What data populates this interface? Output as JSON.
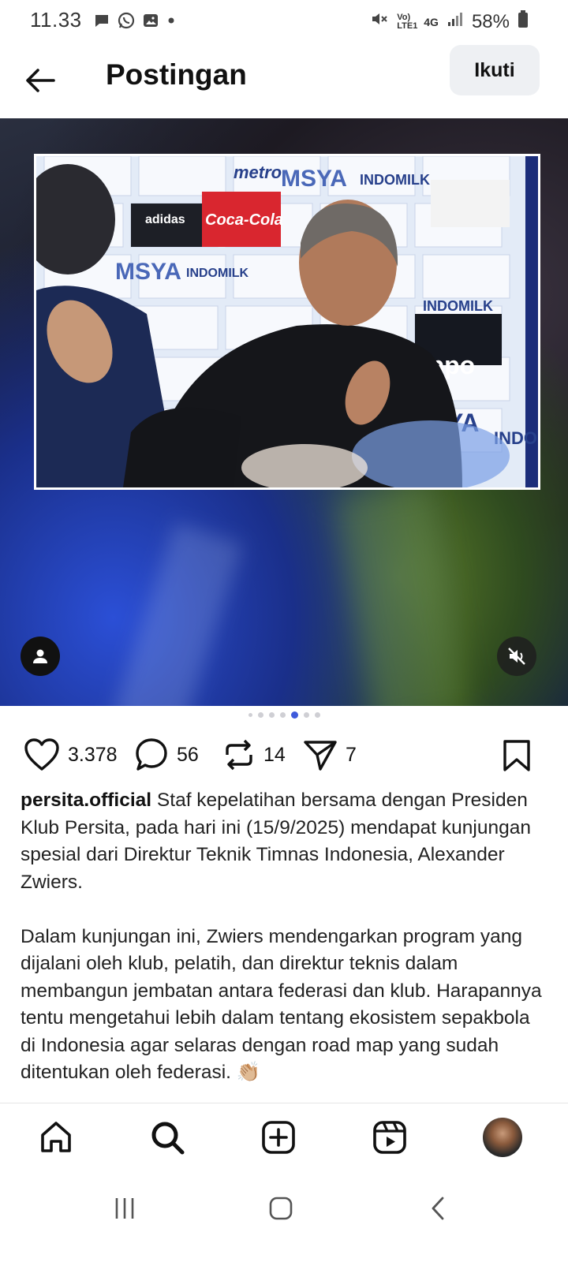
{
  "status_bar": {
    "time": "11.33",
    "network_label": "Vo) LTE1",
    "network_type": "4G",
    "battery": "58%",
    "icons": [
      "chat-icon",
      "whatsapp-icon",
      "gallery-icon",
      "dot-icon",
      "mute-icon",
      "signal-icon",
      "battery-icon"
    ]
  },
  "header": {
    "title": "Postingan",
    "follow_label": "Ikuti"
  },
  "media": {
    "sponsors": [
      "metro",
      "MSYA",
      "INDOMILK",
      "adidas",
      "Coca-Cola",
      "MSYA",
      "INDOMILK",
      "INDOMILK",
      "oppo",
      "YA",
      "INDO"
    ],
    "carousel_total": 7,
    "carousel_active": 5
  },
  "actions": {
    "likes": "3.378",
    "comments": "56",
    "reposts": "14",
    "shares": "7"
  },
  "caption": {
    "username": "persita.official",
    "paragraph1": "Staf kepelatihan bersama dengan Presiden Klub Persita, pada hari ini (15/9/2025) mendapat kunjungan spesial dari Direktur Teknik Timnas Indonesia, Alexander Zwiers.",
    "paragraph2": "Dalam kunjungan ini, Zwiers mendengarkan program yang dijalani oleh klub, pelatih, dan direktur teknis dalam membangun jembatan antara federasi dan klub. Harapannya tentu mengetahui lebih dalam tentang ekosistem sepakbola di Indonesia agar selaras dengan road map yang sudah ditentukan oleh federasi. 👏🏼"
  },
  "bottom_nav": [
    "home-icon",
    "search-icon",
    "create-icon",
    "reels-icon",
    "profile-avatar"
  ],
  "colors": {
    "accent": "#3f5bdb",
    "follow_bg": "#eef0f3"
  }
}
